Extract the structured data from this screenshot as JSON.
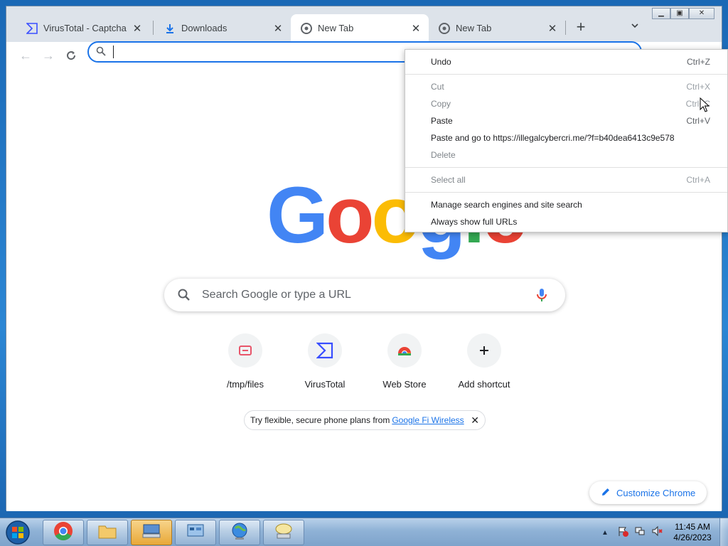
{
  "browser": {
    "tabs": [
      {
        "label": "VirusTotal - Captcha",
        "icon": "virustotal-icon"
      },
      {
        "label": "Downloads",
        "icon": "download-icon"
      },
      {
        "label": "New Tab",
        "icon": "chrome-icon",
        "active": true
      },
      {
        "label": "New Tab",
        "icon": "chrome-icon"
      }
    ],
    "omnibox": {
      "value": "",
      "placeholder": ""
    }
  },
  "newtab": {
    "logo": [
      "G",
      "o",
      "o",
      "g",
      "l",
      "e"
    ],
    "search_placeholder": "Search Google or type a URL",
    "shortcuts": [
      {
        "label": "/tmp/files",
        "icon": "tmp-files-icon"
      },
      {
        "label": "VirusTotal",
        "icon": "virustotal-icon"
      },
      {
        "label": "Web Store",
        "icon": "webstore-icon"
      },
      {
        "label": "Add shortcut",
        "icon": "plus-icon"
      }
    ],
    "promo": {
      "text": "Try flexible, secure phone plans from",
      "link": "Google Fi Wireless"
    },
    "customize_label": "Customize Chrome"
  },
  "context_menu": {
    "items": [
      {
        "label": "Undo",
        "shortcut": "Ctrl+Z",
        "enabled": true
      },
      {
        "label": "Cut",
        "shortcut": "Ctrl+X",
        "enabled": false
      },
      {
        "label": "Copy",
        "shortcut": "Ctrl+C",
        "enabled": false
      },
      {
        "label": "Paste",
        "shortcut": "Ctrl+V",
        "enabled": true
      },
      {
        "label": "Paste and go to https://illegalcybercri.me/?f=b40dea6413c9e578",
        "shortcut": "",
        "enabled": true
      },
      {
        "label": "Delete",
        "shortcut": "",
        "enabled": false
      },
      {
        "label": "Select all",
        "shortcut": "Ctrl+A",
        "enabled": false
      },
      {
        "label": "Manage search engines and site search",
        "shortcut": "",
        "enabled": true
      },
      {
        "label": "Always show full URLs",
        "shortcut": "",
        "enabled": true
      }
    ]
  },
  "taskbar": {
    "clock_time": "11:45 AM",
    "clock_date": "4/26/2023"
  },
  "colors": {
    "accent": "#1a73e8",
    "google_blue": "#4285f4",
    "google_red": "#ea4335",
    "google_yellow": "#fbbc05",
    "google_green": "#34a853"
  }
}
